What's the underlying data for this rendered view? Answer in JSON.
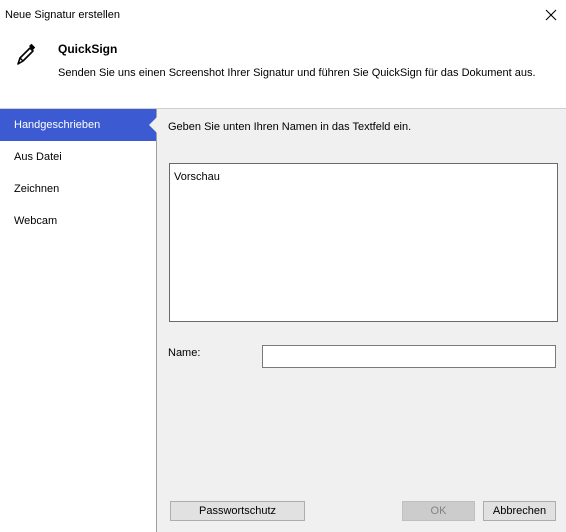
{
  "window": {
    "title": "Neue Signatur erstellen",
    "close_icon": "close-icon"
  },
  "header": {
    "icon": "pen-icon",
    "title": "QuickSign",
    "subtitle": "Senden Sie uns einen Screenshot Ihrer Signatur und führen Sie QuickSign für das Dokument aus."
  },
  "sidebar": {
    "active_index": 0,
    "items": [
      {
        "label": "Handgeschrieben"
      },
      {
        "label": "Aus Datei"
      },
      {
        "label": "Zeichnen"
      },
      {
        "label": "Webcam"
      }
    ]
  },
  "content": {
    "instruction": "Geben Sie unten Ihren Namen in das Textfeld ein.",
    "preview_label": "Vorschau",
    "name_label": "Name:",
    "name_value": ""
  },
  "buttons": {
    "password": "Passwortschutz",
    "ok": "OK",
    "cancel": "Abbrechen"
  },
  "colors": {
    "accent": "#3c5ad2",
    "panel_background": "#f0f0f0",
    "disabled_text": "#838383"
  }
}
